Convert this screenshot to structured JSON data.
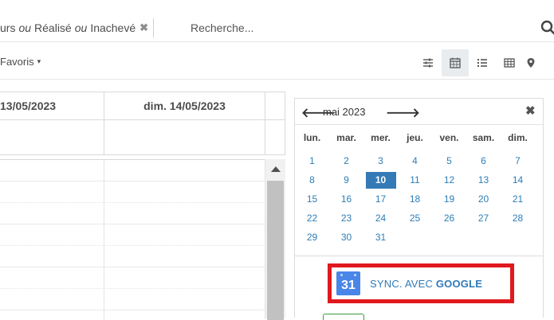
{
  "search": {
    "facet_part1": "urs",
    "facet_or1": "ou",
    "facet_part2": "Réalisé",
    "facet_or2": "ou",
    "facet_part3": "Inachevé",
    "facet_remove": "✖",
    "placeholder": "Recherche..."
  },
  "controls": {
    "favorites_label": "Favoris",
    "favorites_caret": "▾"
  },
  "views": [
    {
      "name": "settings-sliders-icon"
    },
    {
      "name": "calendar-icon",
      "active": true
    },
    {
      "name": "list-icon"
    },
    {
      "name": "table-icon"
    },
    {
      "name": "map-pin-icon"
    }
  ],
  "calendar": {
    "day_col1": "13/05/2023",
    "day_col2": "dim. 14/05/2023"
  },
  "mini_calendar": {
    "prev": "🡐",
    "month": "mai 2023",
    "next": "🡒",
    "close": "✖",
    "days_of_week": [
      "lun.",
      "mar.",
      "mer.",
      "jeu.",
      "ven.",
      "sam.",
      "dim."
    ],
    "weeks": [
      [
        "1",
        "2",
        "3",
        "4",
        "5",
        "6",
        "7"
      ],
      [
        "8",
        "9",
        "10",
        "11",
        "12",
        "13",
        "14"
      ],
      [
        "15",
        "16",
        "17",
        "18",
        "19",
        "20",
        "21"
      ],
      [
        "22",
        "23",
        "24",
        "25",
        "26",
        "27",
        "28"
      ],
      [
        "29",
        "30",
        "31",
        "",
        "",
        "",
        ""
      ]
    ],
    "selected": "10"
  },
  "sync": {
    "icon_number": "31",
    "label_prefix": "SYNC. AVEC ",
    "label_brand": "GOOGLE"
  },
  "colors": {
    "accent": "#337ab7",
    "link": "#2c7db6",
    "highlight_border": "#e0191e",
    "google_blue": "#4a86e8"
  }
}
